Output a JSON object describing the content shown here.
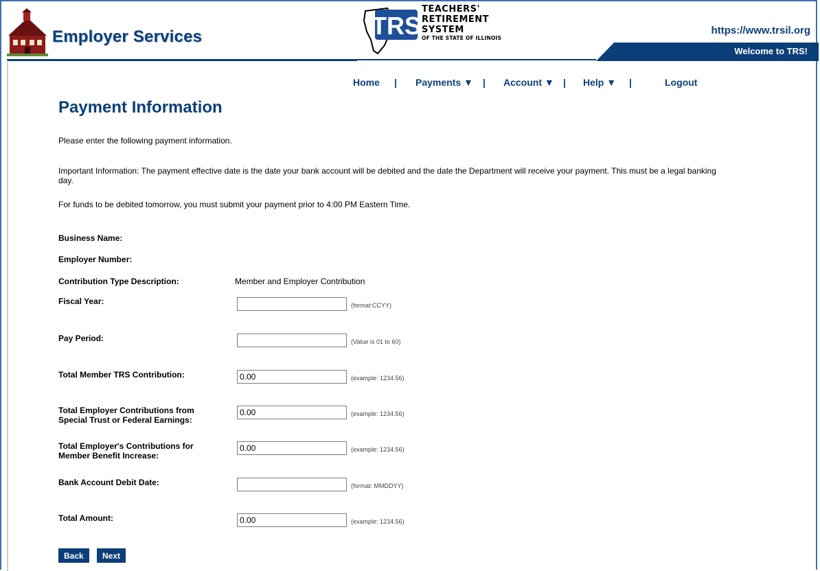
{
  "header": {
    "app_title": "Employer Services",
    "trs_logo_text": "TRS",
    "trs_name_line1": "TEACHERS'",
    "trs_name_line2": "RETIREMENT",
    "trs_name_line3": "SYSTEM",
    "trs_name_line4": "OF THE STATE OF ILLINOIS",
    "url": "https://www.trsil.org",
    "welcome": "Welcome to TRS!",
    "accent_color": "#0b3f7a"
  },
  "nav": {
    "home": "Home",
    "payments": "Payments ▼",
    "account": "Account ▼",
    "help": "Help ▼",
    "logout": "Logout",
    "separator": "|"
  },
  "page": {
    "title": "Payment Information",
    "intro": "Please enter the following payment information.",
    "important": "Important Information: The payment effective date is the date your bank account will be debited and the date the Department will receive your payment. This must be a legal banking day.",
    "funds_note": "For funds to be debited tomorrow, you must submit your payment prior to 4:00 PM Eastern Time."
  },
  "form": {
    "business_name_label": "Business Name:",
    "employer_number_label": "Employer Number:",
    "contribution_type_label": "Contribution Type Description:",
    "contribution_type_value": "Member and Employer Contribution",
    "fiscal_year": {
      "label": "Fiscal Year:",
      "value": "",
      "hint": "(format:CCYY)"
    },
    "pay_period": {
      "label": "Pay Period:",
      "value": "",
      "hint": "(Value is 01 to 60)"
    },
    "member_trs": {
      "label": "Total Member TRS Contribution:",
      "value": "0.00",
      "hint": "(example: 1234.56)"
    },
    "special_trust": {
      "label": "Total Employer Contributions from Special Trust or Federal Earnings:",
      "value": "0.00",
      "hint": "(example: 1234.56)"
    },
    "benefit_increase": {
      "label": "Total Employer's Contributions for Member Benefit Increase:",
      "value": "0.00",
      "hint": "(example: 1234.56)"
    },
    "debit_date": {
      "label": "Bank Account Debit Date:",
      "value": "",
      "hint": "(format: MMDDYY)"
    },
    "total_amount": {
      "label": "Total Amount:",
      "value": "0.00",
      "hint": "(example: 1234.56)"
    }
  },
  "buttons": {
    "back": "Back",
    "next": "Next"
  }
}
